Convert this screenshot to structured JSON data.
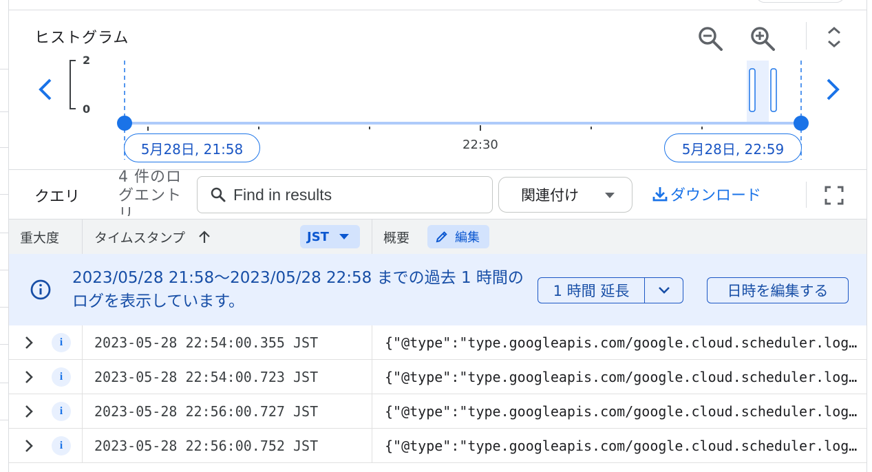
{
  "histogram": {
    "title": "ヒストグラム",
    "y_max": "2",
    "y_min": "0",
    "start_time": "5月28日, 21:58",
    "mid_time": "22:30",
    "end_time": "5月28日, 22:59",
    "accent_color": "#1a73e8"
  },
  "toolbar": {
    "query_tab": "クエリ",
    "log_count": "4 件のログエントリ",
    "search_placeholder": "Find in results",
    "correlate_label": "関連付け",
    "download_label": "ダウンロード"
  },
  "columns": {
    "severity": "重大度",
    "timestamp": "タイムスタンプ",
    "timezone": "JST",
    "summary": "概要",
    "edit": "編集"
  },
  "banner": {
    "message": "2023/05/28 21:58〜2023/05/28 22:58 までの過去 1 時間のログを表示しています。",
    "extend_label": "1 時間 延長",
    "edit_datetime_label": "日時を編集する"
  },
  "rows": [
    {
      "severity": "i",
      "timestamp": "2023-05-28 22:54:00.355 JST",
      "summary": "{\"@type\":\"type.googleapis.com/google.cloud.scheduler.logging.AttemptStarted\"}"
    },
    {
      "severity": "i",
      "timestamp": "2023-05-28 22:54:00.723 JST",
      "summary": "{\"@type\":\"type.googleapis.com/google.cloud.scheduler.logging.AttemptFinished\"}"
    },
    {
      "severity": "i",
      "timestamp": "2023-05-28 22:56:00.727 JST",
      "summary": "{\"@type\":\"type.googleapis.com/google.cloud.scheduler.logging.AttemptStarted\"}"
    },
    {
      "severity": "i",
      "timestamp": "2023-05-28 22:56:00.752 JST",
      "summary": "{\"@type\":\"type.googleapis.com/google.cloud.scheduler.logging.AttemptFinished\"}"
    }
  ]
}
